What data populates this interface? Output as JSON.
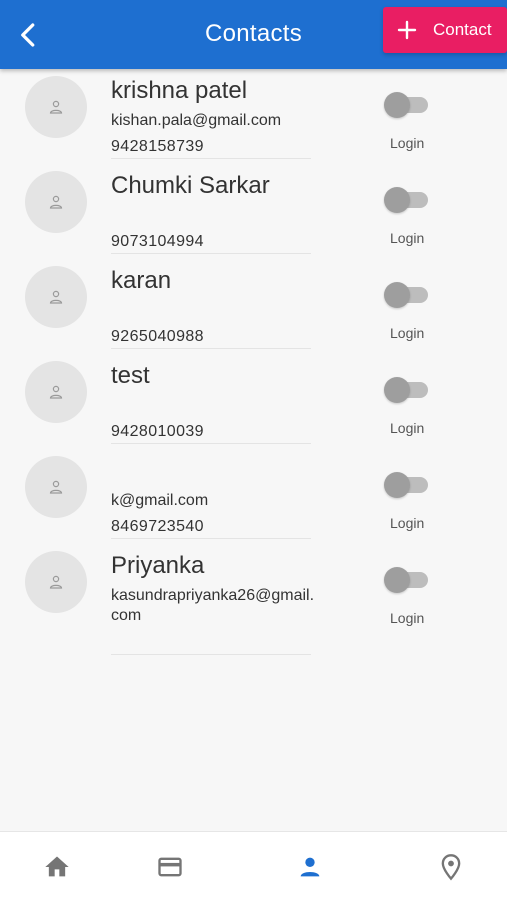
{
  "header": {
    "title": "Contacts",
    "back_icon": "chevron-left-icon",
    "add_button_label": "Contact",
    "add_icon": "plus-icon",
    "background": "#1e6fd0",
    "accent": "#e91e63"
  },
  "contacts": [
    {
      "name": "krishna patel",
      "email": "kishan.pala@gmail.com",
      "phone": "9428158739",
      "login_label": "Login",
      "login_enabled": false
    },
    {
      "name": "Chumki Sarkar",
      "email": "",
      "phone": "9073104994",
      "login_label": "Login",
      "login_enabled": false
    },
    {
      "name": "karan",
      "email": "",
      "phone": "9265040988",
      "login_label": "Login",
      "login_enabled": false
    },
    {
      "name": "test",
      "email": "",
      "phone": "9428010039",
      "login_label": "Login",
      "login_enabled": false
    },
    {
      "name": "",
      "email": "k@gmail.com",
      "phone": "8469723540",
      "login_label": "Login",
      "login_enabled": false
    },
    {
      "name": "Priyanka",
      "email": "kasundrapriyanka26@gmail.com",
      "phone": "",
      "login_label": "Login",
      "login_enabled": false
    }
  ],
  "bottom_nav": {
    "items": [
      {
        "icon": "home-icon",
        "active": false
      },
      {
        "icon": "card-icon",
        "active": false
      },
      {
        "icon": "person-icon",
        "active": true
      },
      {
        "icon": "location-pin-icon",
        "active": false
      }
    ],
    "active_color": "#1e6fd0",
    "inactive_color": "#757575"
  }
}
